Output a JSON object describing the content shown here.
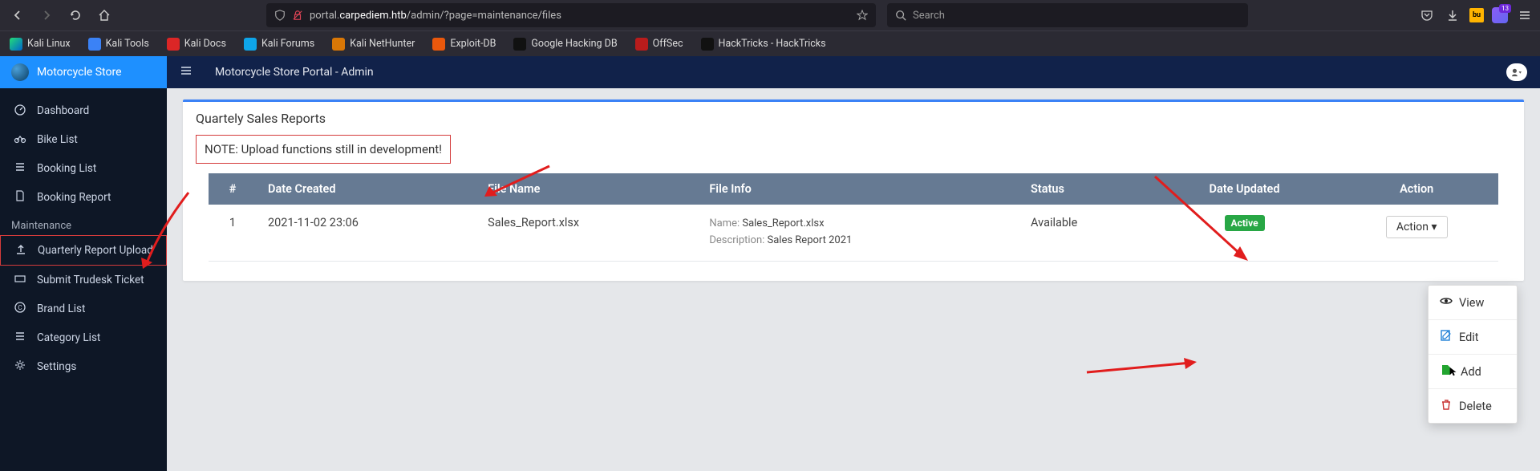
{
  "browser": {
    "url_prefix": "portal.",
    "url_host": "carpediem.htb",
    "url_path": "/admin/?page=maintenance/files",
    "search_placeholder": "Search",
    "ext_badge": "13"
  },
  "bookmarks": [
    {
      "label": "Kali Linux"
    },
    {
      "label": "Kali Tools"
    },
    {
      "label": "Kali Docs"
    },
    {
      "label": "Kali Forums"
    },
    {
      "label": "Kali NetHunter"
    },
    {
      "label": "Exploit-DB"
    },
    {
      "label": "Google Hacking DB"
    },
    {
      "label": "OffSec"
    },
    {
      "label": "HackTricks - HackTricks"
    }
  ],
  "brand": "Motorcycle Store",
  "topbar_title": "Motorcycle Store Portal - Admin",
  "sidebar": {
    "items": [
      {
        "label": "Dashboard"
      },
      {
        "label": "Bike List"
      },
      {
        "label": "Booking List"
      },
      {
        "label": "Booking Report"
      }
    ],
    "section": "Maintenance",
    "maint": [
      {
        "label": "Quarterly Report Upload"
      },
      {
        "label": "Submit Trudesk Ticket"
      },
      {
        "label": "Brand List"
      },
      {
        "label": "Category List"
      },
      {
        "label": "Settings"
      }
    ]
  },
  "card": {
    "title": "Quartely Sales Reports",
    "note": "NOTE: Upload functions still in development!"
  },
  "table": {
    "headers": {
      "num": "#",
      "created": "Date Created",
      "filename": "File Name",
      "info": "File Info",
      "status": "Status",
      "updated": "Date Updated",
      "action": "Action"
    },
    "rows": [
      {
        "num": "1",
        "created": "2021-11-02 23:06",
        "filename": "Sales_Report.xlsx",
        "info_name_lbl": "Name: ",
        "info_name_val": "Sales_Report.xlsx",
        "info_desc_lbl": "Description: ",
        "info_desc_val": "Sales Report 2021",
        "status": "Available",
        "updated_badge": "Active",
        "action_label": "Action"
      }
    ]
  },
  "dropdown": {
    "view": "View",
    "edit": "Edit",
    "add": "Add",
    "delete": "Delete"
  }
}
